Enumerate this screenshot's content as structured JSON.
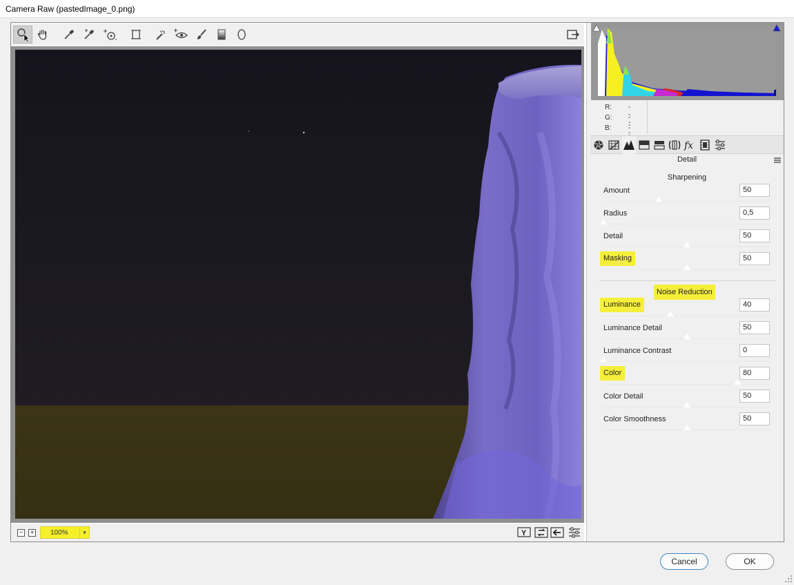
{
  "window": {
    "title": "Camera Raw (pastedImage_0.png)"
  },
  "toolbar": {
    "tools": [
      {
        "name": "zoom-tool",
        "icon": "magnifier-icon",
        "active": true
      },
      {
        "name": "hand-tool",
        "icon": "hand-icon"
      },
      {
        "name": "white-balance-tool",
        "icon": "eyedropper-icon"
      },
      {
        "name": "color-sampler-tool",
        "icon": "color-sampler-icon"
      },
      {
        "name": "targeted-adjustment-tool",
        "icon": "target-adjust-icon"
      },
      {
        "name": "transform-tool",
        "icon": "transform-icon"
      },
      {
        "name": "spot-removal-tool",
        "icon": "spot-removal-icon"
      },
      {
        "name": "red-eye-tool",
        "icon": "red-eye-icon"
      },
      {
        "name": "adjustment-brush-tool",
        "icon": "brush-icon"
      },
      {
        "name": "graduated-filter-tool",
        "icon": "gradient-icon"
      },
      {
        "name": "radial-filter-tool",
        "icon": "ellipse-icon"
      }
    ],
    "open_preferences": "preferences-export-icon"
  },
  "bottom": {
    "zoom_value": "100%",
    "zoom_out_symbol": "−",
    "zoom_in_symbol": "+",
    "icons": [
      "before-after-y-icon",
      "swap-icon",
      "copy-settings-icon",
      "preview-prefs-icon"
    ]
  },
  "info": {
    "r_label": "R:",
    "r_value": "---",
    "g_label": "G:",
    "g_value": "---",
    "b_label": "B:",
    "b_value": "---"
  },
  "tabs": [
    "basic-tab-icon",
    "tone-curve-tab-icon",
    "detail-tab-icon",
    "hsl-tab-icon",
    "split-toning-tab-icon",
    "lens-corrections-tab-icon",
    "effects-tab-icon",
    "camera-calibration-tab-icon",
    "presets-tab-icon"
  ],
  "panel": {
    "title": "Detail",
    "sharpening": {
      "heading": "Sharpening",
      "amount": {
        "label": "Amount",
        "value": "50",
        "fraction": 0.33
      },
      "radius": {
        "label": "Radius",
        "value": "0,5",
        "fraction": 0.0
      },
      "detail": {
        "label": "Detail",
        "value": "50",
        "fraction": 0.5
      },
      "masking": {
        "label": "Masking",
        "value": "50",
        "fraction": 0.5
      }
    },
    "noise": {
      "heading": "Noise Reduction",
      "luminance": {
        "label": "Luminance",
        "value": "40",
        "fraction": 0.4
      },
      "luminance_detail": {
        "label": "Luminance Detail",
        "value": "50",
        "fraction": 0.5
      },
      "luminance_contrast": {
        "label": "Luminance Contrast",
        "value": "0",
        "fraction": 0.0
      },
      "color": {
        "label": "Color",
        "value": "80",
        "fraction": 0.8
      },
      "color_detail": {
        "label": "Color Detail",
        "value": "50",
        "fraction": 0.5
      },
      "color_smoothness": {
        "label": "Color Smoothness",
        "value": "50",
        "fraction": 0.5
      }
    }
  },
  "buttons": {
    "cancel": "Cancel",
    "ok": "OK"
  },
  "colors": {
    "highlight": "#f5ef3a",
    "preview_sky": "#1b1a25",
    "preview_ground": "#3a3416",
    "rock": "#6a5fc8"
  }
}
